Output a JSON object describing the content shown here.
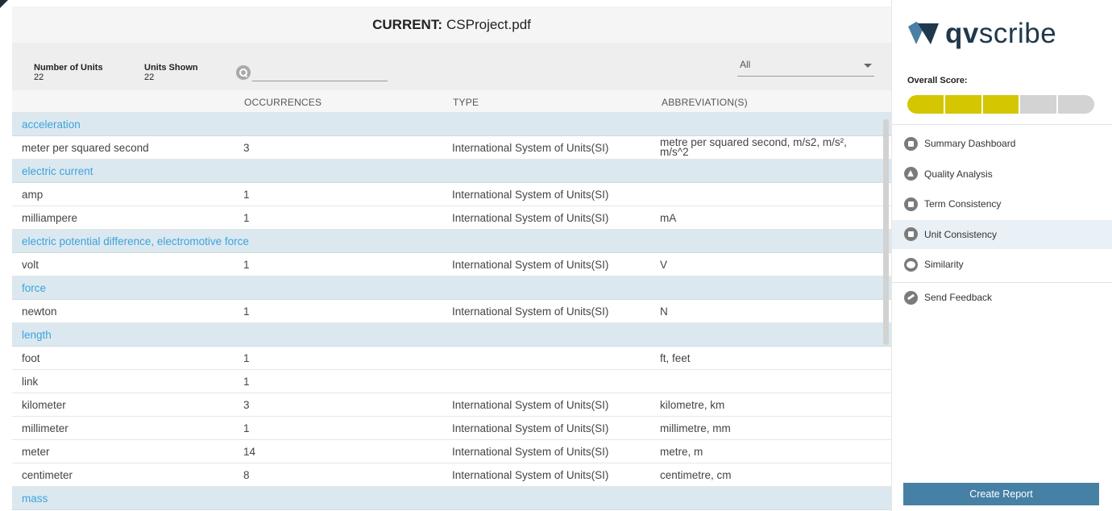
{
  "header": {
    "current_label": "CURRENT:",
    "file_name": "CSProject.pdf"
  },
  "toolbar": {
    "number_of_units_label": "Number of Units",
    "number_of_units_value": "22",
    "units_shown_label": "Units Shown",
    "units_shown_value": "22",
    "search_placeholder": "",
    "filter_value": "All"
  },
  "table": {
    "columns": {
      "occurrences": "OCCURRENCES",
      "type": "TYPE",
      "abbreviations": "ABBREVIATION(S)"
    },
    "rows": [
      {
        "kind": "group",
        "name": "acceleration"
      },
      {
        "kind": "unit",
        "name": "meter per squared second",
        "occurrences": "3",
        "type": "International System of Units(SI)",
        "abbreviations": "metre per squared second, m/s2, m/s², m/s^2"
      },
      {
        "kind": "group",
        "name": "electric current"
      },
      {
        "kind": "unit",
        "name": "amp",
        "occurrences": "1",
        "type": "International System of Units(SI)",
        "abbreviations": ""
      },
      {
        "kind": "unit",
        "name": "milliampere",
        "occurrences": "1",
        "type": "International System of Units(SI)",
        "abbreviations": "mA"
      },
      {
        "kind": "group",
        "name": "electric potential difference, electromotive force"
      },
      {
        "kind": "unit",
        "name": "volt",
        "occurrences": "1",
        "type": "International System of Units(SI)",
        "abbreviations": "V"
      },
      {
        "kind": "group",
        "name": "force"
      },
      {
        "kind": "unit",
        "name": "newton",
        "occurrences": "1",
        "type": "International System of Units(SI)",
        "abbreviations": "N"
      },
      {
        "kind": "group",
        "name": "length"
      },
      {
        "kind": "unit",
        "name": "foot",
        "occurrences": "1",
        "type": "",
        "abbreviations": "ft, feet"
      },
      {
        "kind": "unit",
        "name": "link",
        "occurrences": "1",
        "type": "",
        "abbreviations": ""
      },
      {
        "kind": "unit",
        "name": "kilometer",
        "occurrences": "3",
        "type": "International System of Units(SI)",
        "abbreviations": "kilometre, km"
      },
      {
        "kind": "unit",
        "name": "millimeter",
        "occurrences": "1",
        "type": "International System of Units(SI)",
        "abbreviations": "millimetre, mm"
      },
      {
        "kind": "unit",
        "name": "meter",
        "occurrences": "14",
        "type": "International System of Units(SI)",
        "abbreviations": "metre, m"
      },
      {
        "kind": "unit",
        "name": "centimeter",
        "occurrences": "8",
        "type": "International System of Units(SI)",
        "abbreviations": "centimetre, cm"
      },
      {
        "kind": "group",
        "name": "mass"
      }
    ]
  },
  "sidebar": {
    "logo_bold": "qv",
    "logo_light": "scribe",
    "overall_score_label": "Overall Score:",
    "score": {
      "filled": 3,
      "total": 5,
      "filled_color": "#d4c600",
      "empty_color": "#d3d3d3"
    },
    "nav": [
      {
        "label": "Summary Dashboard",
        "icon": "dashboard-icon"
      },
      {
        "label": "Quality Analysis",
        "icon": "warning-icon"
      },
      {
        "label": "Term Consistency",
        "icon": "book-icon"
      },
      {
        "label": "Unit Consistency",
        "icon": "unit-icon",
        "active": true
      },
      {
        "label": "Similarity",
        "icon": "similarity-icon"
      }
    ],
    "feedback_label": "Send Feedback",
    "create_report_label": "Create Report"
  }
}
